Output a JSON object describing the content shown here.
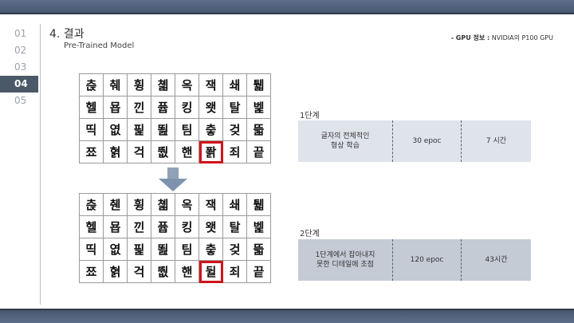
{
  "nav": {
    "items": [
      "01",
      "02",
      "03",
      "04",
      "05"
    ],
    "active_index": 3
  },
  "header": {
    "title": "4. 결과",
    "subtitle": "Pre-Trained Model",
    "gpu_label": "- GPU 정보 :",
    "gpu_value": " NVIDIA의 P100 GPU"
  },
  "grid_top": {
    "rows": [
      [
        "츥",
        "췌",
        "휭",
        "쳷",
        "옥",
        "잭",
        "쇄",
        "퉯"
      ],
      [
        "헬",
        "묩",
        "낀",
        "퓹",
        "킹",
        "왯",
        "탈",
        "벭"
      ],
      [
        "띡",
        "엾",
        "핉",
        "뙲",
        "팀",
        "춯",
        "겆",
        "뜳"
      ],
      [
        "쬬",
        "혉",
        "걱",
        "뛊",
        "핸",
        "퐑",
        "죄",
        "끝"
      ]
    ],
    "highlight": {
      "row": 3,
      "col": 5
    }
  },
  "grid_bottom": {
    "rows": [
      [
        "츥",
        "췐",
        "휭",
        "쳷",
        "옥",
        "잭",
        "쇄",
        "퉯"
      ],
      [
        "헬",
        "묩",
        "낀",
        "퓹",
        "킹",
        "왯",
        "탈",
        "벭"
      ],
      [
        "띡",
        "엾",
        "핉",
        "뙲",
        "팀",
        "춯",
        "겆",
        "뜳"
      ],
      [
        "쬬",
        "혉",
        "걱",
        "뛊",
        "핸",
        "뒬",
        "죄",
        "끝"
      ]
    ],
    "highlight": {
      "row": 3,
      "col": 5
    }
  },
  "stages": [
    {
      "label": "1단계",
      "description_line1": "글자의 전체적인",
      "description_line2": "형상 학습",
      "epochs": "30 epoc",
      "duration": "7 시간"
    },
    {
      "label": "2단계",
      "description_line1": "1단계에서 잡아내지",
      "description_line2": "못한 디테일에 초점",
      "epochs": "120 epoc",
      "duration": "43시간"
    }
  ],
  "colors": {
    "header_bar": "#4f5f78",
    "active_nav": "#4a5868",
    "highlight": "#d0131b",
    "arrow": "#8fa2b8",
    "stage1_bg": "#dfe3ea",
    "stage2_bg": "#c5cbd5"
  }
}
